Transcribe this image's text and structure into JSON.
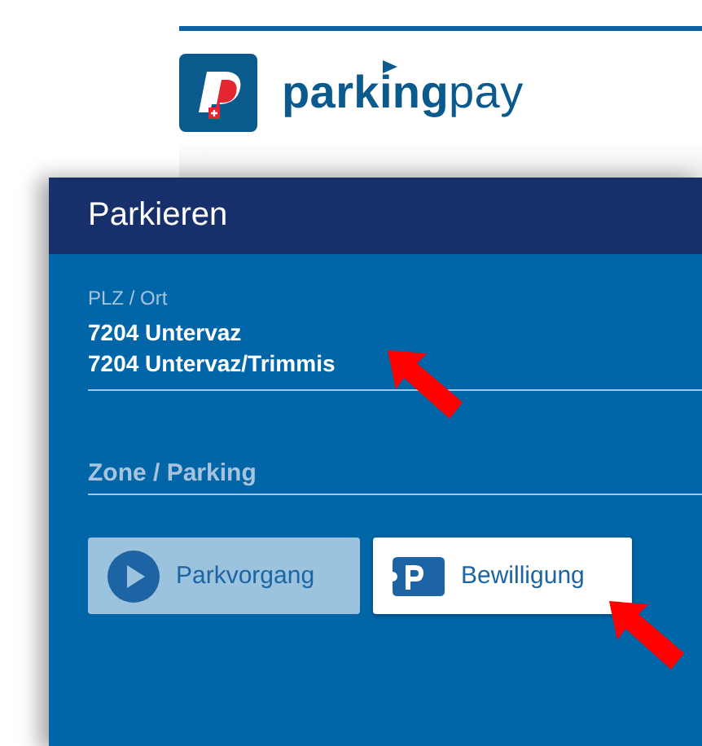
{
  "logo": {
    "wordmark": "**parking**pay"
  },
  "dialog": {
    "title": "Parkieren",
    "location_field": {
      "label": "PLZ / Ort",
      "values": [
        "7204 Untervaz",
        "7204 Untervaz/Trimmis"
      ]
    },
    "zone_field": {
      "placeholder": "Zone / Parking"
    },
    "buttons": [
      {
        "label": "Parkvorgang",
        "kind": "play",
        "disabled": true
      },
      {
        "label": "Bewilligung",
        "kind": "permit",
        "disabled": false
      }
    ]
  }
}
